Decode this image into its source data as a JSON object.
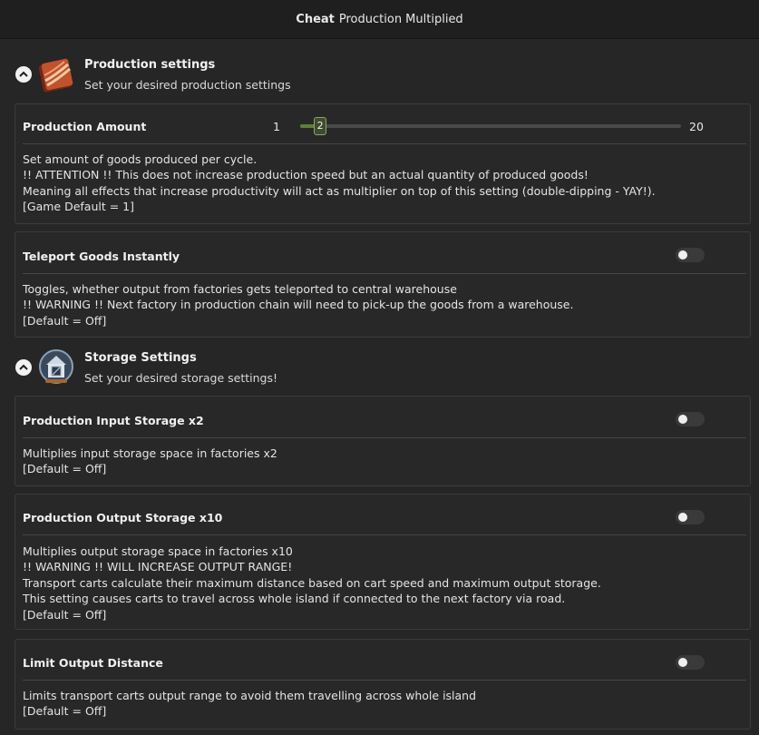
{
  "window": {
    "title_bold": "Cheat",
    "title_rest": "Production Multiplied"
  },
  "sections": [
    {
      "title": "Production settings",
      "subtitle": "Set your desired production settings",
      "icon": "production-book-icon"
    },
    {
      "title": "Storage Settings",
      "subtitle": "Set your desired storage settings!",
      "icon": "warehouse-icon"
    }
  ],
  "settings": {
    "production_amount": {
      "label": "Production Amount",
      "min": "1",
      "max": "20",
      "value": "2",
      "value_num": 2,
      "min_num": 1,
      "max_num": 20,
      "description": [
        "Set amount of goods produced per cycle.",
        "!! ATTENTION !! This does not increase production speed but an actual quantity of produced goods!",
        "Meaning all effects that increase productivity will act as multiplier on top of this setting (double-dipping - YAY!).",
        "[Game Default = 1]"
      ]
    },
    "teleport_goods": {
      "label": "Teleport Goods Instantly",
      "enabled": false,
      "description": [
        "Toggles, whether output from factories gets teleported to central warehouse",
        "!! WARNING !! Next factory in production chain will need to pick-up the goods from a warehouse.",
        "[Default = Off]"
      ]
    },
    "input_storage": {
      "label": "Production Input Storage x2",
      "enabled": false,
      "description": [
        "Multiplies input storage space in factories x2",
        "[Default = Off]"
      ]
    },
    "output_storage": {
      "label": "Production Output Storage x10",
      "enabled": false,
      "description": [
        "Multiplies output storage space in factories x10",
        "!! WARNING !! WILL INCREASE OUTPUT RANGE!",
        "Transport carts calculate their maximum distance based on cart speed and maximum output storage.",
        "This setting causes carts to travel across whole island if connected to the next factory via road.",
        "[Default = Off]"
      ]
    },
    "limit_distance": {
      "label": "Limit Output Distance",
      "enabled": false,
      "description": [
        "Limits transport carts output range to avoid them travelling across whole island",
        "[Default = Off]"
      ]
    }
  },
  "colors": {
    "background": "#262626",
    "slider_fill": "#5f7f3c",
    "toggle_off": "#3a3a3a"
  }
}
